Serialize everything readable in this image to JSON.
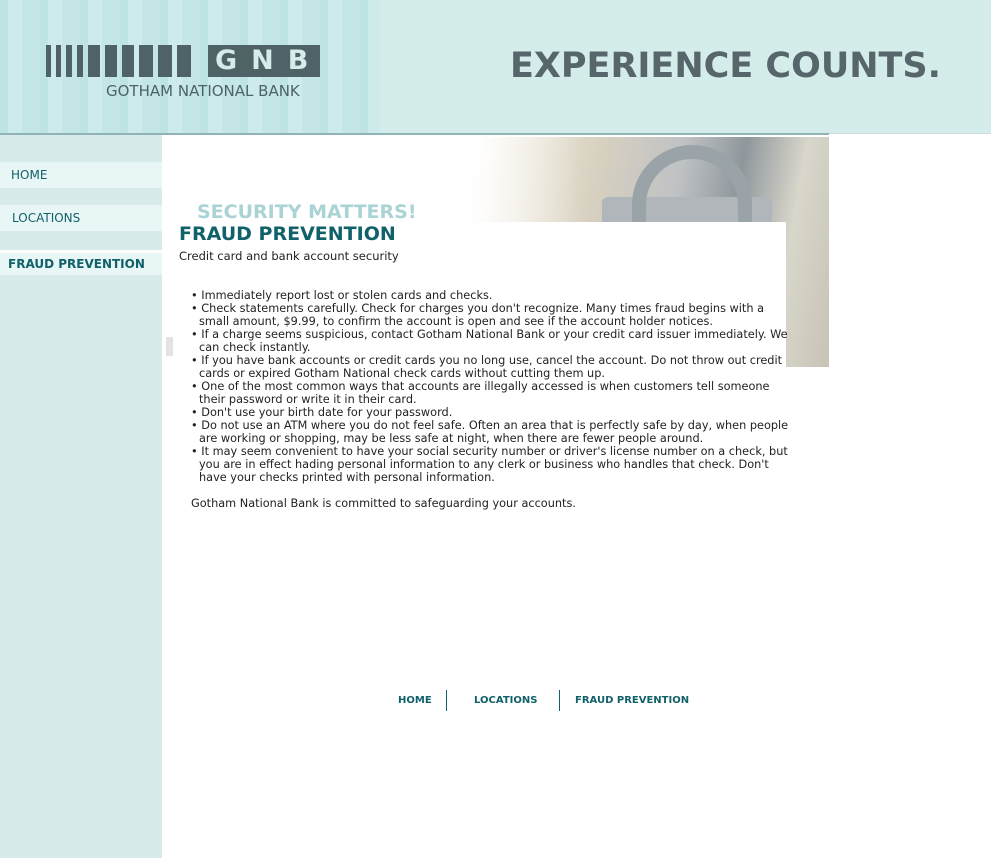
{
  "brand": {
    "logo_letters": "GNB",
    "name": "GOTHAM NATIONAL BANK",
    "tagline": "EXPERIENCE COUNTS."
  },
  "nav": {
    "items": [
      {
        "label": "HOME"
      },
      {
        "label": "LOCATIONS"
      },
      {
        "label": "FRAUD PREVENTION"
      }
    ]
  },
  "banner": {
    "text": "SECURITY MATTERS!"
  },
  "page": {
    "title": "FRAUD PREVENTION",
    "subtitle": "Credit card and bank account security",
    "tips": [
      "Immediately report lost or stolen cards and checks.",
      "Check statements carefully. Check for charges you don't recognize. Many times fraud begins with a small amount, $9.99, to confirm the account is open and see if the account holder notices.",
      "If a charge seems suspicious, contact Gotham National Bank or your credit card issuer immediately. We can check instantly.",
      "If you have bank accounts or credit cards you no long use, cancel the account. Do not throw out credit cards or expired Gotham National check cards without cutting them up.",
      "One of the most common ways that accounts are illegally accessed is when customers tell someone their password or write it in their card.",
      "Don't use your birth date for your password.",
      "Do not use an ATM where you do not feel safe. Often an area that is perfectly safe by day, when people are working or shopping, may be less safe at night, when there are fewer people around.",
      "It may seem convenient to have your social security number or driver's license number on a check, but you are in effect hading personal information to any clerk or business who handles that check. Don't have your checks printed with personal information."
    ],
    "closing": "Gotham National Bank is committed to safeguarding your accounts."
  },
  "footer": {
    "links": [
      {
        "label": "HOME"
      },
      {
        "label": "LOCATIONS"
      },
      {
        "label": "FRAUD PREVENTION"
      }
    ]
  }
}
